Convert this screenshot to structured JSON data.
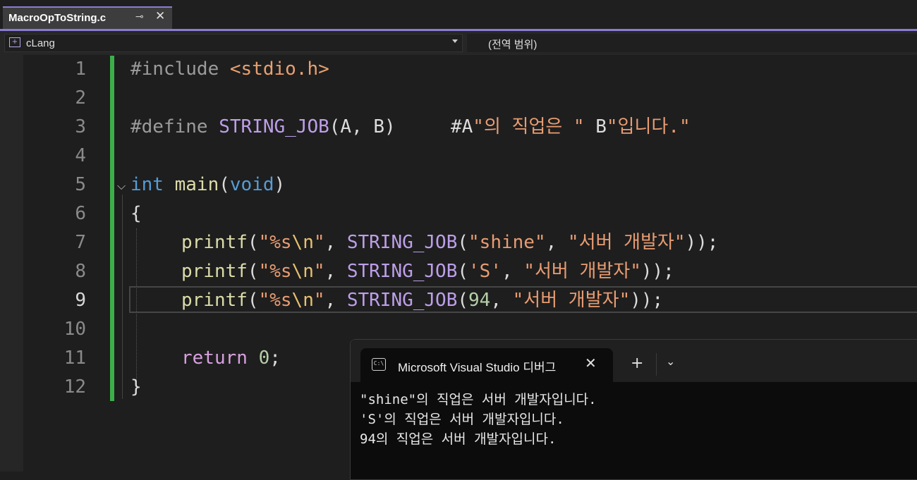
{
  "tab": {
    "title": "MacroOpToString.c",
    "pin_glyph": "⊸",
    "close_glyph": "✕"
  },
  "navbar": {
    "project": "cLang",
    "scope": "(전역 범위)"
  },
  "editor": {
    "line_numbers": [
      "1",
      "2",
      "3",
      "4",
      "5",
      "6",
      "7",
      "8",
      "9",
      "10",
      "11",
      "12"
    ],
    "active_line": 9,
    "code": {
      "l1": {
        "pp": "#include ",
        "inc": "<stdio.h>"
      },
      "l3": {
        "pp": "#define ",
        "mac": "STRING_JOB",
        "args": "(A, B)",
        "pad": "     ",
        "s1": "#A",
        "str1": "\"의 직업은 \"",
        "s2": " B",
        "str2": "\"입니다.\""
      },
      "l5": {
        "kw1": "int",
        "fn": " main",
        "p1": "(",
        "kw2": "void",
        "p2": ")"
      },
      "l6": {
        "brace": "{"
      },
      "l7": {
        "fn": "printf",
        "p1": "(",
        "fmt": "\"%s",
        "esc": "\\n",
        "fmt2": "\"",
        "c": ", ",
        "mac": "STRING_JOB",
        "p2": "(",
        "s1": "\"shine\"",
        "c2": ", ",
        "s2": "\"서버 개발자\"",
        "end": "));"
      },
      "l8": {
        "fn": "printf",
        "p1": "(",
        "fmt": "\"%s",
        "esc": "\\n",
        "fmt2": "\"",
        "c": ", ",
        "mac": "STRING_JOB",
        "p2": "(",
        "s1": "'S'",
        "c2": ", ",
        "s2": "\"서버 개발자\"",
        "end": "));"
      },
      "l9": {
        "fn": "printf",
        "p1": "(",
        "fmt": "\"%s",
        "esc": "\\n",
        "fmt2": "\"",
        "c": ", ",
        "mac": "STRING_JOB",
        "p2": "(",
        "n1": "94",
        "c2": ", ",
        "s2": "\"서버 개발자\"",
        "end": "));"
      },
      "l11": {
        "kw": "return",
        "n": " 0",
        "end": ";"
      },
      "l12": {
        "brace": "}"
      }
    }
  },
  "terminal": {
    "tab_title": "Microsoft Visual Studio 디버그",
    "icon_text": "C:\\",
    "close_glyph": "✕",
    "new_tab_glyph": "+",
    "dropdown_glyph": "⌄",
    "output": [
      "\"shine\"의 직업은 서버 개발자입니다.",
      "'S'의 직업은 서버 개발자입니다.",
      "94의 직업은 서버 개발자입니다."
    ]
  },
  "colors": {
    "accent": "#8a7cd4",
    "changebar": "#3cae4a",
    "keyword": "#569cd6",
    "string": "#e89c72",
    "macro": "#bd9fe8",
    "function": "#dcdcaa"
  }
}
